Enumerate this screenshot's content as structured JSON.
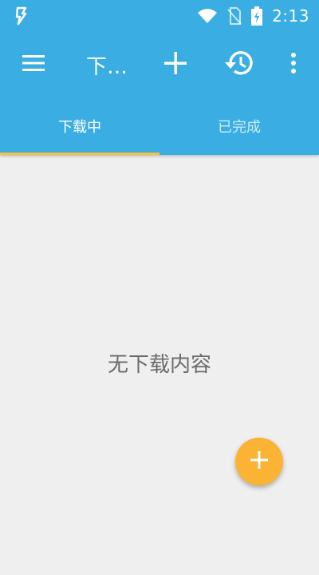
{
  "status_bar": {
    "time": "2:13",
    "icons": [
      "flash-app-icon",
      "wifi-icon",
      "no-sim-icon",
      "battery-charging-icon"
    ]
  },
  "toolbar": {
    "title": "下…",
    "icons": [
      "menu-icon",
      "add-icon",
      "history-icon",
      "more-vert-icon"
    ]
  },
  "tabs": [
    {
      "label": "下载中",
      "selected": true
    },
    {
      "label": "已完成",
      "selected": false
    }
  ],
  "empty_state": {
    "message": "无下载内容"
  },
  "fab": {
    "icon": "add-icon"
  },
  "colors": {
    "primary": "#3aaee2",
    "tab_indicator": "#f5c23a",
    "fab": "#fbb335",
    "background": "#efefef"
  }
}
